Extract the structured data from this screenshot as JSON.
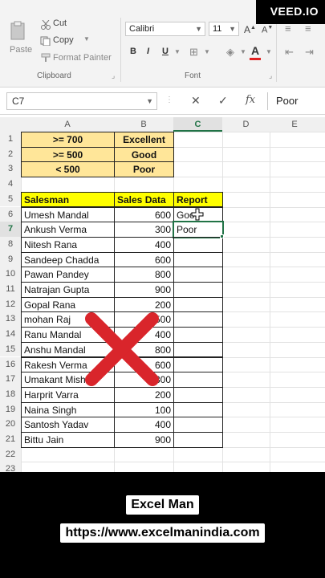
{
  "ribbon": {
    "clipboard": {
      "paste": "Paste",
      "cut": "Cut",
      "copy": "Copy",
      "format_painter": "Format Painter",
      "group_label": "Clipboard"
    },
    "font": {
      "name": "Calibri",
      "size": "11",
      "bold": "B",
      "italic": "I",
      "underline": "U",
      "group_label": "Font",
      "font_color": "#e02020"
    }
  },
  "formula_bar": {
    "name_box": "C7",
    "cancel": "✕",
    "confirm": "✓",
    "fx": "fx",
    "value": "Poor"
  },
  "columns": [
    "A",
    "B",
    "C",
    "D",
    "E"
  ],
  "active_column": "C",
  "rows": [
    "1",
    "2",
    "3",
    "4",
    "5",
    "6",
    "7",
    "8",
    "9",
    "10",
    "11",
    "12",
    "13",
    "14",
    "15",
    "16",
    "17",
    "18",
    "19",
    "20",
    "21",
    "22",
    "23"
  ],
  "active_row": "7",
  "criteria": [
    {
      "threshold": ">= 700",
      "grade": "Excellent"
    },
    {
      "threshold": ">= 500",
      "grade": "Good"
    },
    {
      "threshold": "< 500",
      "grade": "Poor"
    }
  ],
  "table": {
    "headers": [
      "Salesman",
      "Sales Data",
      "Report"
    ],
    "rows": [
      {
        "name": "Umesh Mandal",
        "sales": "600",
        "report": "Goo"
      },
      {
        "name": "Ankush Verma",
        "sales": "300",
        "report": "Poor"
      },
      {
        "name": "Nitesh Rana",
        "sales": "400",
        "report": ""
      },
      {
        "name": "Sandeep Chadda",
        "sales": "600",
        "report": ""
      },
      {
        "name": "Pawan Pandey",
        "sales": "800",
        "report": ""
      },
      {
        "name": "Natrajan Gupta",
        "sales": "900",
        "report": ""
      },
      {
        "name": "Gopal Rana",
        "sales": "200",
        "report": ""
      },
      {
        "name": "mohan Raj",
        "sales": "500",
        "report": ""
      },
      {
        "name": "Ranu Mandal",
        "sales": "400",
        "report": ""
      },
      {
        "name": "Anshu Mandal",
        "sales": "800",
        "report": ""
      },
      {
        "name": "Rakesh Verma",
        "sales": "600",
        "report": ""
      },
      {
        "name": "Umakant Mishra",
        "sales": "300",
        "report": ""
      },
      {
        "name": "Harprit Varra",
        "sales": "200",
        "report": ""
      },
      {
        "name": "Naina Singh",
        "sales": "100",
        "report": ""
      },
      {
        "name": "Santosh Yadav",
        "sales": "400",
        "report": ""
      },
      {
        "name": "Bittu Jain",
        "sales": "900",
        "report": ""
      }
    ]
  },
  "overlay": {
    "watermark": "VEED.IO",
    "channel": "Excel Man",
    "url": "https://www.excelmanindia.com",
    "x_color": "#d9252b"
  }
}
